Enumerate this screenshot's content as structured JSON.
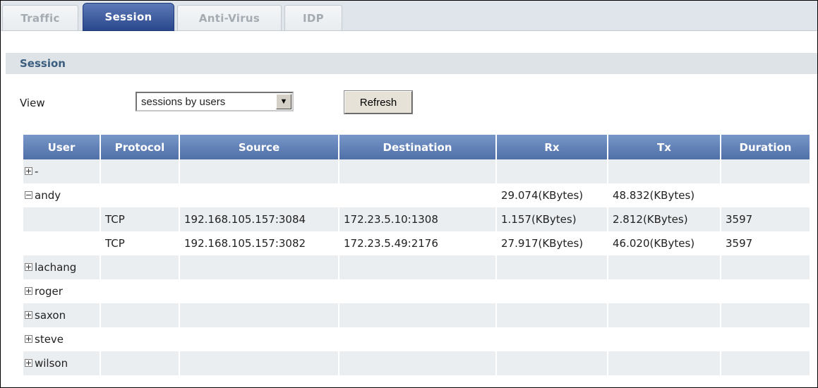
{
  "tabs": [
    {
      "label": "Traffic",
      "active": false
    },
    {
      "label": "Session",
      "active": true
    },
    {
      "label": "Anti-Virus",
      "active": false
    },
    {
      "label": "IDP",
      "active": false
    }
  ],
  "section": {
    "title": "Session"
  },
  "controls": {
    "view_label": "View",
    "view_selected": "sessions by users",
    "refresh_label": "Refresh"
  },
  "table": {
    "columns": [
      "User",
      "Protocol",
      "Source",
      "Destination",
      "Rx",
      "Tx",
      "Duration"
    ],
    "rows": [
      {
        "user": "-",
        "expanded": false,
        "protocol": "",
        "source": "",
        "destination": "",
        "rx": "",
        "tx": "",
        "duration": ""
      },
      {
        "user": "andy",
        "expanded": true,
        "protocol": "",
        "source": "",
        "destination": "",
        "rx": "29.074(KBytes)",
        "tx": "48.832(KBytes)",
        "duration": ""
      },
      {
        "user": "",
        "protocol": "TCP",
        "source": "192.168.105.157:3084",
        "destination": "172.23.5.10:1308",
        "rx": "1.157(KBytes)",
        "tx": "2.812(KBytes)",
        "duration": "3597"
      },
      {
        "user": "",
        "protocol": "TCP",
        "source": "192.168.105.157:3082",
        "destination": "172.23.5.49:2176",
        "rx": "27.917(KBytes)",
        "tx": "46.020(KBytes)",
        "duration": "3597"
      },
      {
        "user": "lachang",
        "expanded": false,
        "protocol": "",
        "source": "",
        "destination": "",
        "rx": "",
        "tx": "",
        "duration": ""
      },
      {
        "user": "roger",
        "expanded": false,
        "protocol": "",
        "source": "",
        "destination": "",
        "rx": "",
        "tx": "",
        "duration": ""
      },
      {
        "user": "saxon",
        "expanded": false,
        "protocol": "",
        "source": "",
        "destination": "",
        "rx": "",
        "tx": "",
        "duration": ""
      },
      {
        "user": "steve",
        "expanded": false,
        "protocol": "",
        "source": "",
        "destination": "",
        "rx": "",
        "tx": "",
        "duration": ""
      },
      {
        "user": "wilson",
        "expanded": false,
        "protocol": "",
        "source": "",
        "destination": "",
        "rx": "",
        "tx": "",
        "duration": ""
      }
    ]
  },
  "colors": {
    "active_tab": "#29478c",
    "header_bg": "#5f7fb8",
    "section_bg": "#dde3e7",
    "row_alt": "#eaeef1"
  }
}
